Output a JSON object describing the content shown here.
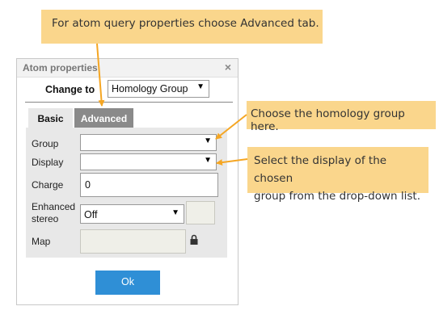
{
  "callouts": {
    "top": "For atom query properties choose Advanced tab.",
    "right1": "Choose the homology group here.",
    "right2_line1": "Select the display of the chosen",
    "right2_line2": "group from the drop-down list."
  },
  "dialog": {
    "title": "Atom properties",
    "close_glyph": "×",
    "change_to_label": "Change to",
    "change_to_value": "Homology Group",
    "tabs": [
      "Basic",
      "Advanced"
    ],
    "active_tab": "Basic",
    "fields": {
      "group_label": "Group",
      "group_value": "",
      "display_label": "Display",
      "display_value": "",
      "charge_label": "Charge",
      "charge_value": "0",
      "enhanced_label_line1": "Enhanced",
      "enhanced_label_line2": "stereo",
      "enhanced_value": "Off",
      "map_label": "Map",
      "map_value": ""
    },
    "ok_label": "Ok",
    "map_lock_icon": "lock-icon",
    "dropdown_arrow_icon": "triangle-down-icon"
  },
  "colors": {
    "callout_bg": "#fad68c",
    "arrow": "#f5a623",
    "ok_button": "#2f8fd6",
    "advanced_tab": "#8a8a8a",
    "panel_bg": "#e8e8e8"
  }
}
